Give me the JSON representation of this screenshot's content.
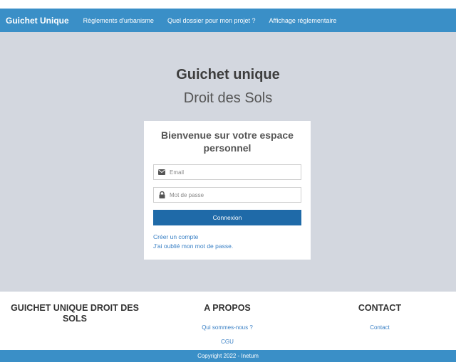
{
  "nav": {
    "brand": "Guichet Unique",
    "items": [
      {
        "label": "Règlements d'urbanisme"
      },
      {
        "label": "Quel dossier pour mon projet ?"
      },
      {
        "label": "Affichage réglementaire"
      }
    ]
  },
  "hero": {
    "title": "Guichet unique",
    "subtitle": "Droit des Sols"
  },
  "login": {
    "heading": "Bienvenue sur votre espace personnel",
    "email_placeholder": "Email",
    "password_placeholder": "Mot de passe",
    "submit_label": "Connexion",
    "create_account": "Créer un compte",
    "forgot_password": "J'ai oublié mon mot de passe."
  },
  "footer": {
    "col1_title": "GUICHET UNIQUE DROIT DES SOLS",
    "col2_title": "A PROPOS",
    "col2_links": [
      {
        "label": "Qui sommes-nous ?"
      },
      {
        "label": "CGU"
      }
    ],
    "col3_title": "CONTACT",
    "col3_links": [
      {
        "label": "Contact"
      }
    ],
    "copyright": "Copyright 2022 - Inetum"
  },
  "colors": {
    "primary": "#3a8fc7",
    "button": "#1f6aa8",
    "background": "#d3d7df",
    "link": "#3a80c5"
  },
  "icons": [
    "envelope-icon",
    "lock-icon"
  ]
}
